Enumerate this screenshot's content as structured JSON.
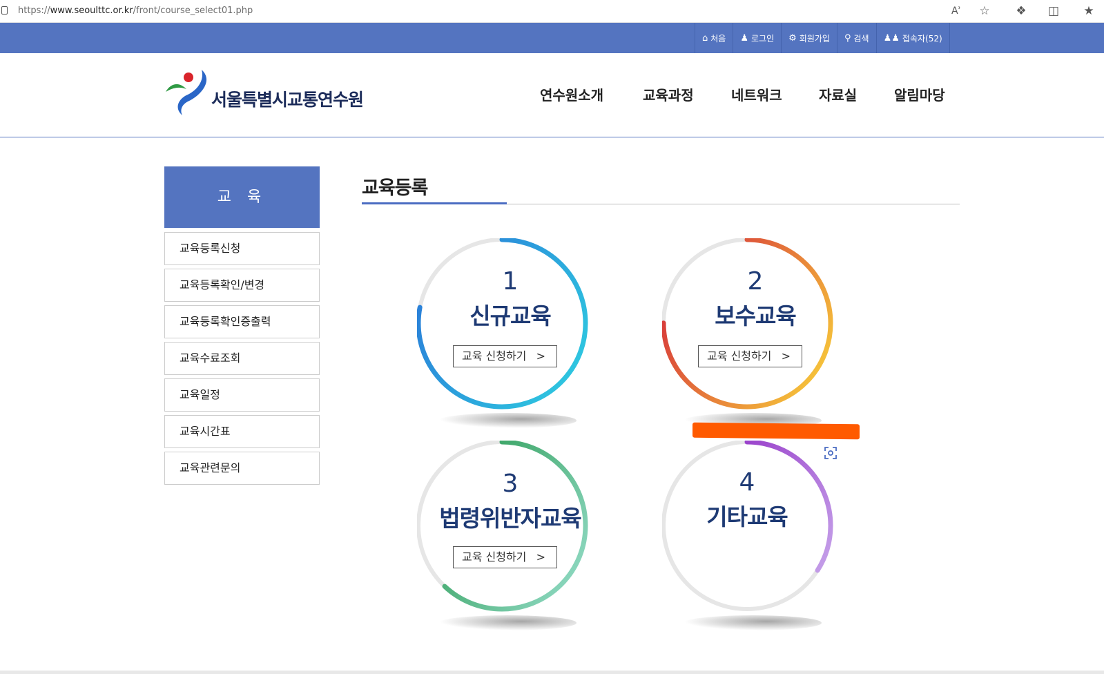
{
  "browser": {
    "url_prefix": "https://",
    "url_host": "www.seoulttc.or.kr",
    "url_path": "/front/course_select01.php",
    "icons": [
      "read-aloud-icon",
      "favorite-star-icon",
      "extensions-icon",
      "split-screen-icon",
      "favorites-icon"
    ]
  },
  "topbar": {
    "items": [
      {
        "icon": "home-icon",
        "label": "처음"
      },
      {
        "icon": "user-icon",
        "label": "로그인"
      },
      {
        "icon": "gear-icon",
        "label": "회원가입"
      },
      {
        "icon": "search-icon",
        "label": "검색"
      },
      {
        "icon": "users-icon",
        "label": "접속자(52)"
      }
    ]
  },
  "header": {
    "logo_text": "서울특별시교통연수원",
    "nav": [
      "연수원소개",
      "교육과정",
      "네트워크",
      "자료실",
      "알림마당"
    ]
  },
  "sidebar": {
    "title": "교 육",
    "items": [
      "교육등록신청",
      "교육등록확인/변경",
      "교육등록확인증출력",
      "교육수료조회",
      "교육일정",
      "교육시간표",
      "교육관련문의"
    ]
  },
  "content": {
    "title": "교육등록",
    "courses": [
      {
        "num": "1",
        "name": "신규교육",
        "apply": "교육 신청하기",
        "colors": [
          "#2a7ad8",
          "#2ec9e0"
        ],
        "progress": 0.78
      },
      {
        "num": "2",
        "name": "보수교육",
        "apply": "교육 신청하기",
        "colors": [
          "#d42a3a",
          "#f7c93a"
        ],
        "progress": 0.75
      },
      {
        "num": "3",
        "name": "법령위반자교육",
        "apply": "교육 신청하기",
        "colors": [
          "#23954a",
          "#8fd9c2"
        ],
        "progress": 0.62
      },
      {
        "num": "4",
        "name": "기타교육",
        "apply": "",
        "colors": [
          "#8a1fc0",
          "#c6a3ea"
        ],
        "progress": 0.34
      }
    ],
    "chevron": ">"
  },
  "accent_color": "#5474c0",
  "annotation_color": "#ff5a00"
}
